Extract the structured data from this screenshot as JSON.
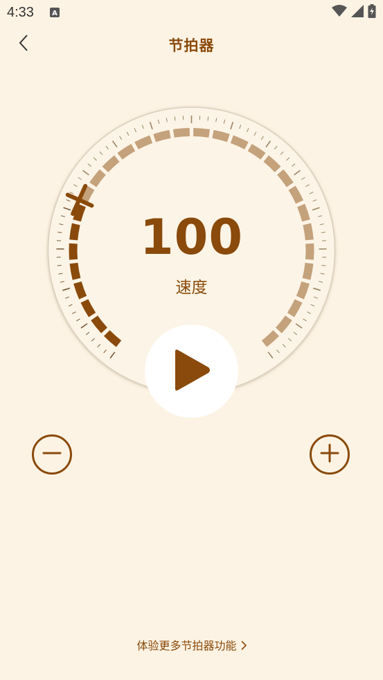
{
  "status_bar": {
    "time": "4:33",
    "icons": [
      "notification-a-icon",
      "wifi-icon",
      "cellular-signal-icon",
      "battery-charging-icon"
    ]
  },
  "header": {
    "title": "节拍器",
    "back_icon": "chevron-left-icon"
  },
  "metronome": {
    "tempo": "100",
    "tempo_label": "速度",
    "play_icon": "play-icon",
    "decrease_icon": "minus-icon",
    "increase_icon": "plus-icon",
    "tempo_progress": 0.27
  },
  "footer": {
    "more_link": "体验更多节拍器功能",
    "more_link_icon": "chevron-right-icon"
  },
  "colors": {
    "background": "#FCF3E4",
    "accent": "#8A4A0B",
    "track_inactive": "#C4A27C",
    "dial_face": "#FCF4E6"
  }
}
